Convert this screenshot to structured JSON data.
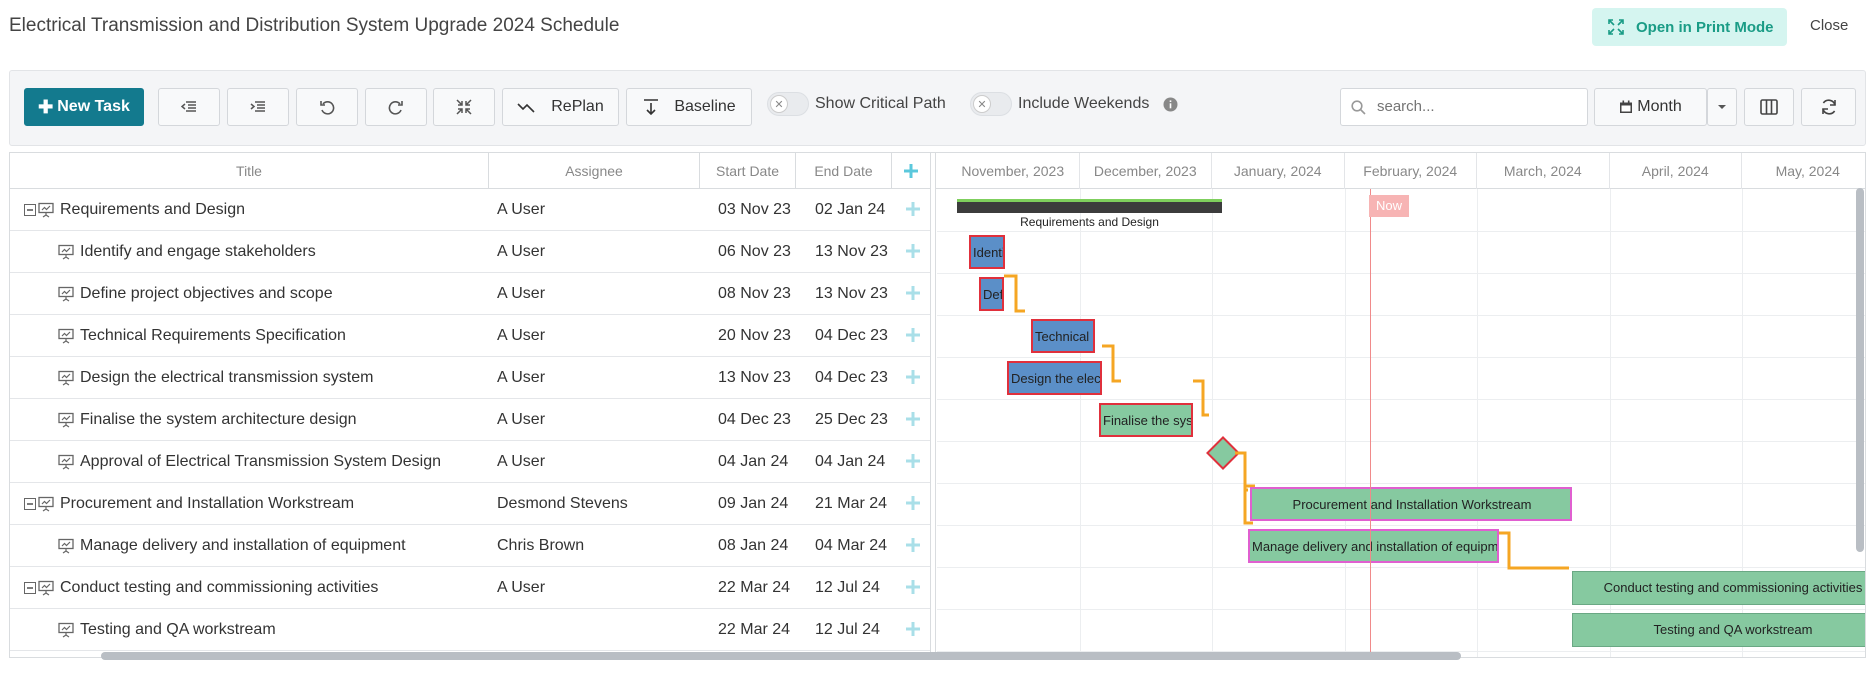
{
  "header": {
    "title": "Electrical Transmission and Distribution System Upgrade 2024 Schedule",
    "print_label": "Open in Print Mode",
    "close_label": "Close"
  },
  "toolbar": {
    "new_task": "New Task",
    "replan": "RePlan",
    "baseline": "Baseline",
    "critical_path": "Show Critical Path",
    "include_weekends": "Include Weekends",
    "search_placeholder": "search...",
    "view": "Month",
    "colors": {
      "primary": "#137a8e",
      "print_bg": "#d5f5f0",
      "print_fg": "#1a9c86"
    }
  },
  "columns": {
    "title": "Title",
    "assignee": "Assignee",
    "start": "Start Date",
    "end": "End Date"
  },
  "months": [
    "November, 2023",
    "December, 2023",
    "January, 2024",
    "February, 2024",
    "March, 2024",
    "April, 2024",
    "May, 2024"
  ],
  "rows": [
    {
      "title": "Requirements and Design",
      "assignee": "A User",
      "start": "03 Nov 23",
      "end": "02 Jan 24"
    },
    {
      "title": "Identify and engage stakeholders",
      "assignee": "A User",
      "start": "06 Nov 23",
      "end": "13 Nov 23"
    },
    {
      "title": "Define project objectives and scope",
      "assignee": "A User",
      "start": "08 Nov 23",
      "end": "13 Nov 23"
    },
    {
      "title": "Technical Requirements Specification",
      "assignee": "A User",
      "start": "20 Nov 23",
      "end": "04 Dec 23"
    },
    {
      "title": "Design the electrical transmission system",
      "assignee": "A User",
      "start": "13 Nov 23",
      "end": "04 Dec 23"
    },
    {
      "title": "Finalise the system architecture design",
      "assignee": "A User",
      "start": "04 Dec 23",
      "end": "25 Dec 23"
    },
    {
      "title": "Approval of Electrical Transmission System Design",
      "assignee": "A User",
      "start": "04 Jan 24",
      "end": "04 Jan 24"
    },
    {
      "title": "Procurement and Installation Workstream",
      "assignee": "Desmond Stevens",
      "start": "09 Jan 24",
      "end": "21 Mar 24"
    },
    {
      "title": "Manage delivery and installation of equipment",
      "assignee": "Chris Brown",
      "start": "08 Jan 24",
      "end": "04 Mar 24"
    },
    {
      "title": "Conduct testing and commissioning activities",
      "assignee": "A User",
      "start": "22 Mar 24",
      "end": "12 Jul 24"
    },
    {
      "title": "Testing and QA workstream",
      "assignee": "",
      "start": "22 Mar 24",
      "end": "12 Jul 24"
    }
  ],
  "gantt": {
    "summary_label": "Requirements and Design",
    "now_label": "Now",
    "bars": [
      "Identify and engage stakeholders",
      "Define project objectives and scope",
      "Technical Requirements Specification",
      "Design the electrical transmission system",
      "Finalise the system architecture design",
      "Procurement and Installation Workstream",
      "Manage delivery and installation of equipment",
      "Conduct testing and commissioning activities",
      "Testing and QA workstream"
    ]
  }
}
